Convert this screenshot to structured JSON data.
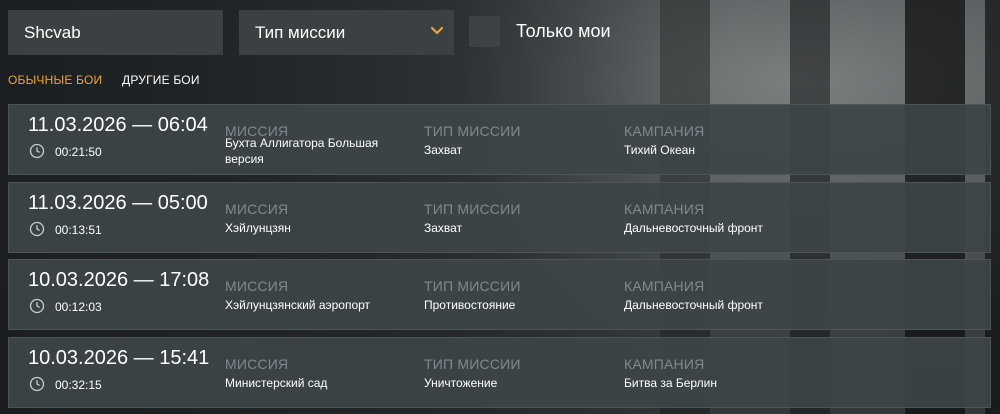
{
  "search": {
    "value": "Shcvab"
  },
  "mission_type_select": {
    "selected": "Тип миссии"
  },
  "only_mine": {
    "label": "Только мои",
    "checked": false
  },
  "tabs": [
    {
      "label": "ОБЫЧНЫЕ БОИ",
      "active": true
    },
    {
      "label": "ДРУГИЕ БОИ",
      "active": false
    }
  ],
  "columns": {
    "mission": "МИССИЯ",
    "mission_type": "ТИП МИССИИ",
    "campaign": "КАМПАНИЯ"
  },
  "battles": [
    {
      "datetime": "11.03.2026 — 06:04",
      "duration": "00:21:50",
      "mission": "Бухта Аллигатора Большая версия",
      "mission_type": "Захват",
      "campaign": "Тихий Океан"
    },
    {
      "datetime": "11.03.2026 — 05:00",
      "duration": "00:13:51",
      "mission": "Хэйлунцзян",
      "mission_type": "Захват",
      "campaign": "Дальневосточный фронт"
    },
    {
      "datetime": "10.03.2026 — 17:08",
      "duration": "00:12:03",
      "mission": "Хэйлунцзянский аэропорт",
      "mission_type": "Противостояние",
      "campaign": "Дальневосточный фронт"
    },
    {
      "datetime": "10.03.2026 — 15:41",
      "duration": "00:32:15",
      "mission": "Министерский сад",
      "mission_type": "Уничтожение",
      "campaign": "Битва за Берлин"
    }
  ],
  "colors": {
    "accent": "#f0a33a",
    "card_bg": "#3d4548",
    "muted_header": "#7f8a8e"
  }
}
